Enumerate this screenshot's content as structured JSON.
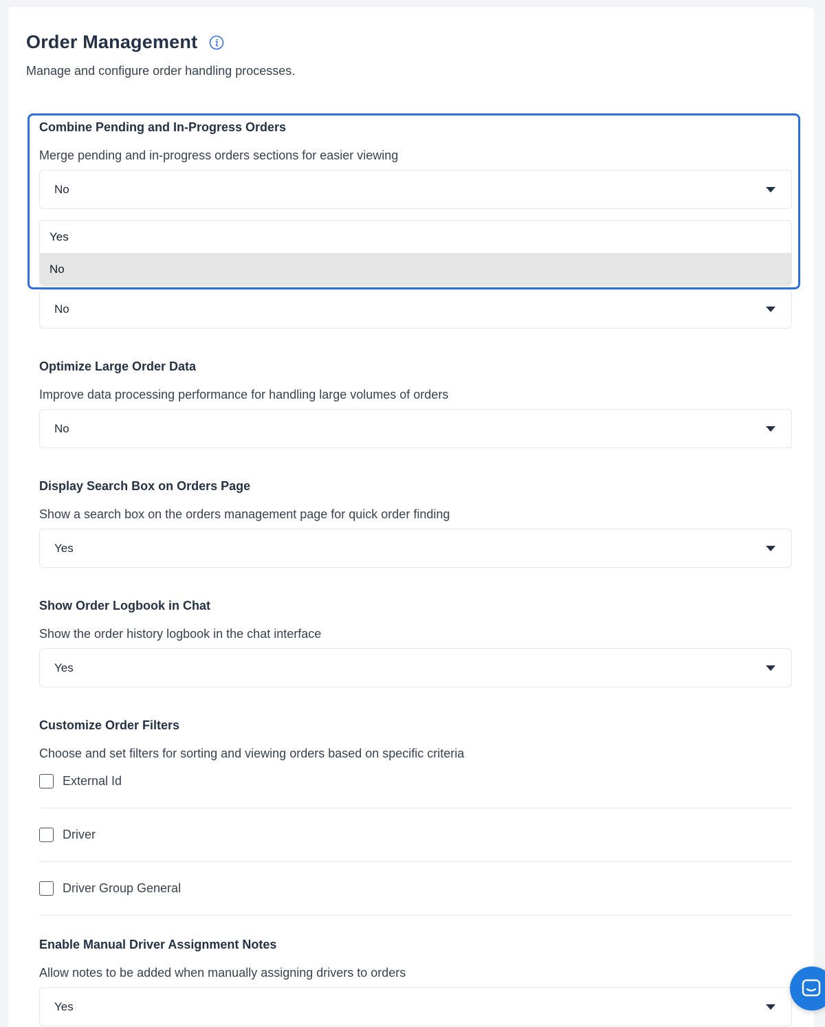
{
  "page": {
    "title": "Order Management",
    "subtitle": "Manage and configure order handling processes."
  },
  "settings": [
    {
      "title": "Combine Pending and In-Progress Orders",
      "description": "Merge pending and in-progress orders sections for easier viewing",
      "value": "No",
      "dropdown_open": true,
      "options": [
        "Yes",
        "No"
      ],
      "selected_option": "No"
    },
    {
      "title": "",
      "description": "",
      "value": "No"
    },
    {
      "title": "Optimize Large Order Data",
      "description": "Improve data processing performance for handling large volumes of orders",
      "value": "No"
    },
    {
      "title": "Display Search Box on Orders Page",
      "description": "Show a search box on the orders management page for quick order finding",
      "value": "Yes"
    },
    {
      "title": "Show Order Logbook in Chat",
      "description": "Show the order history logbook in the chat interface",
      "value": "Yes"
    },
    {
      "title": "Customize Order Filters",
      "description": "Choose and set filters for sorting and viewing orders based on specific criteria",
      "filters": [
        {
          "label": "External Id",
          "checked": false
        },
        {
          "label": "Driver",
          "checked": false
        },
        {
          "label": "Driver Group General",
          "checked": false
        }
      ]
    },
    {
      "title": "Enable Manual Driver Assignment Notes",
      "description": "Allow notes to be added when manually assigning drivers to orders",
      "value": "Yes"
    }
  ],
  "colors": {
    "focus_border": "#2f6fdc",
    "chat_launcher": "#1f7ae0",
    "selected_option_bg": "#e5e5e5"
  },
  "icons": {
    "info": "info-icon",
    "dropdown": "caret-down-icon",
    "chat": "chat-bubble-icon"
  }
}
